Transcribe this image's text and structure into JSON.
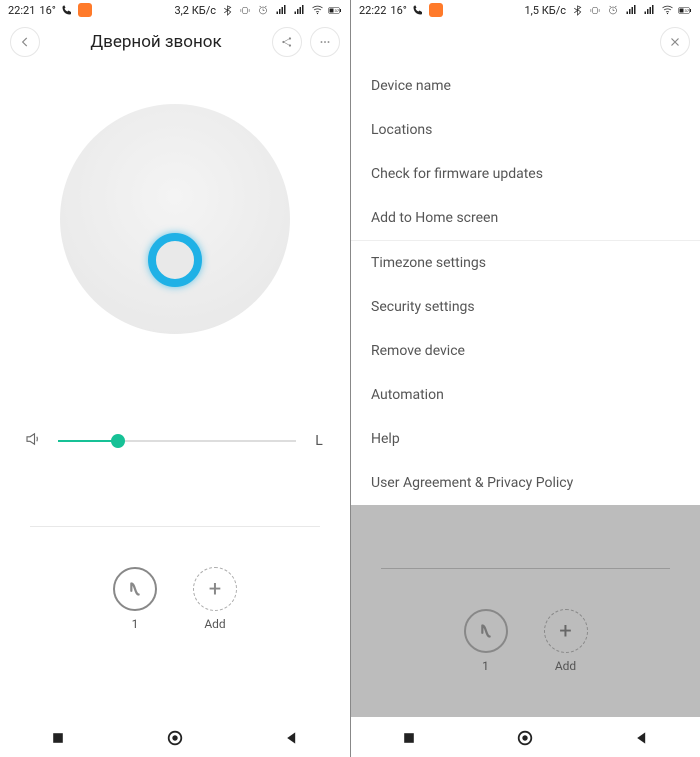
{
  "left": {
    "status": {
      "time": "22:21",
      "temp": "16°",
      "rate": "3,2 КБ/с",
      "battery": "37"
    },
    "header": {
      "title": "Дверной звонок"
    },
    "volume": {
      "level_percent": 25,
      "right_label": "L"
    },
    "actions": {
      "preset_label": "1",
      "add_label": "Add",
      "add_symbol": "+"
    }
  },
  "right": {
    "status": {
      "time": "22:22",
      "temp": "16°",
      "rate": "1,5 КБ/с",
      "battery": "37"
    },
    "menu": {
      "items": [
        "Device name",
        "Locations",
        "Check for firmware updates",
        "Add to Home screen",
        "Timezone settings",
        "Security settings",
        "Remove device",
        "Automation",
        "Help",
        "User Agreement & Privacy Policy"
      ],
      "separator_after_index": 3
    },
    "underlay_actions": {
      "preset_label": "1",
      "add_label": "Add",
      "add_symbol": "+"
    }
  }
}
